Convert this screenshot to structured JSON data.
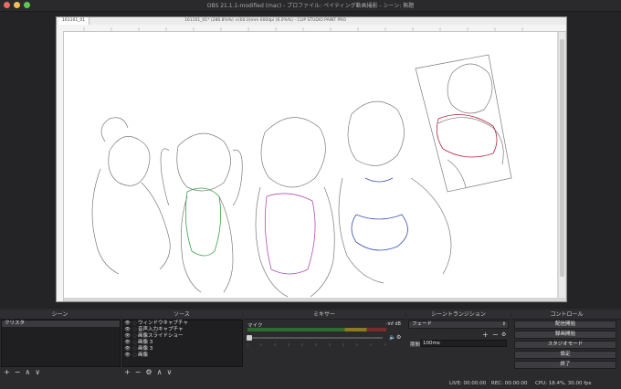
{
  "window": {
    "title": "OBS 21.1.1-modified (mac) - プロファイル: ペイティング動画撮影 - シーン: 無題"
  },
  "clip_studio": {
    "tab_label": "161101_01",
    "title": "161101_01* (286.8%%) ×(60.0)mm 600dpi (6.0%%) - CLIP STUDIO PAINT PRO"
  },
  "docks": {
    "scenes_title": "シーン",
    "sources_title": "ソース",
    "mixer_title": "ミキサー",
    "transitions_title": "シーントランジション",
    "controls_title": "コントロール"
  },
  "scenes": [
    {
      "label": "クリスタ"
    }
  ],
  "sources": [
    {
      "label": "ウィンドウキャプチャ"
    },
    {
      "label": "音声入力キャプチャ"
    },
    {
      "label": "画像スライドショー"
    },
    {
      "label": "画像 3"
    },
    {
      "label": "画像 3"
    },
    {
      "label": "画像"
    }
  ],
  "mixer": {
    "channel_label": "マイク",
    "db_value": "-inf dB",
    "level": 0.0
  },
  "transitions": {
    "selected": "フェード",
    "duration_label": "期間",
    "duration_value": "100ms"
  },
  "controls": {
    "start_streaming": "配信開始",
    "start_recording": "録画開始",
    "studio_mode": "スタジオモード",
    "settings": "設定",
    "exit": "終了"
  },
  "toolbar_icons": {
    "add": "+",
    "remove": "−",
    "up": "∧",
    "down": "∨",
    "gear": "⚙"
  },
  "status_bar": {
    "live": "LIVE: 00:00:00",
    "rec": "REC: 00:00:00",
    "cpu": "CPU: 18.4%, 30.00 fps"
  },
  "colors": {
    "accent": "#3c3c41",
    "meter_green": "#4caf50",
    "meter_red": "#c0392b"
  }
}
